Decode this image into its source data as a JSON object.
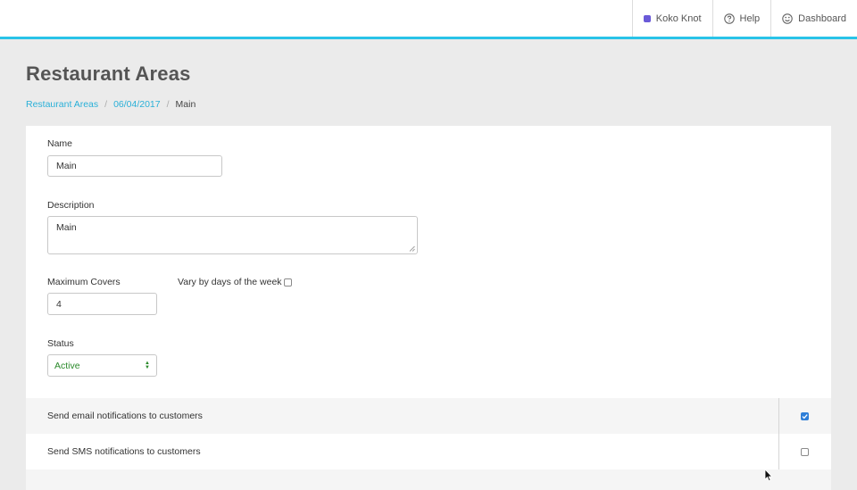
{
  "topnav": {
    "restaurant": "Koko Knot",
    "help": "Help",
    "dashboard": "Dashboard"
  },
  "page": {
    "title": "Restaurant Areas"
  },
  "breadcrumb": {
    "items": [
      "Restaurant Areas",
      "06/04/2017"
    ],
    "current": "Main",
    "separator": "/"
  },
  "form": {
    "name_label": "Name",
    "name_value": "Main",
    "description_label": "Description",
    "description_value": "Main",
    "max_covers_label": "Maximum Covers",
    "max_covers_value": "4",
    "vary_label": "Vary by days of the week",
    "vary_checked": false,
    "status_label": "Status",
    "status_value": "Active"
  },
  "notifications": {
    "email_label": "Send email notifications to customers",
    "email_checked": true,
    "sms_label": "Send SMS notifications to customers",
    "sms_checked": false
  },
  "colors": {
    "accent": "#29c3e8",
    "link": "#2ab0d8",
    "status": "#2b8a2b",
    "restaurant_dot": "#6a5ad8",
    "checkbox_checked": "#2f7fd8"
  }
}
